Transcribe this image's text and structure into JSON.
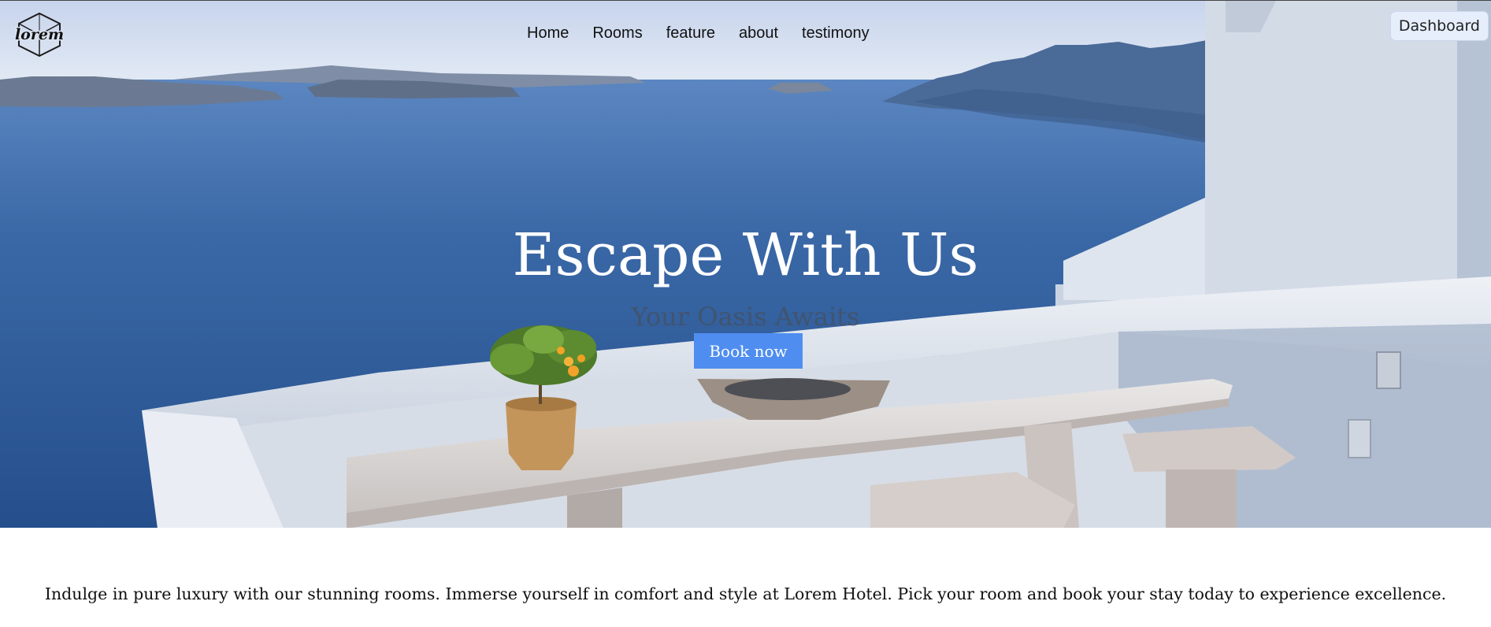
{
  "brand": {
    "logo_text": "lorem"
  },
  "nav": {
    "items": [
      "Home",
      "Rooms",
      "feature",
      "about",
      "testimony"
    ]
  },
  "header": {
    "dashboard_label": "Dashboard"
  },
  "hero": {
    "title": "Escape With Us",
    "subtitle": "Your Oasis Awaits",
    "cta_label": "Book now"
  },
  "intro": {
    "text": "Indulge in pure luxury with our stunning rooms. Immerse yourself in comfort and style at Lorem Hotel. Pick your room and book your stay today to experience excellence."
  },
  "colors": {
    "cta": "#4f8ef0",
    "sea": "#2f5f9a",
    "sky": "#dbe4f1",
    "dashboard_bg": "#e6eefb"
  }
}
